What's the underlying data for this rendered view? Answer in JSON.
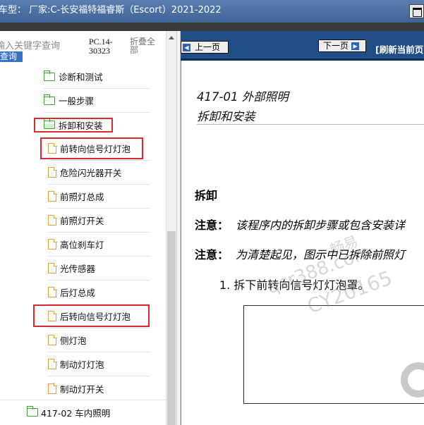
{
  "titlebar": {
    "title": "车型： 厂家:C-长安福特福睿斯（Escort）2021-2022"
  },
  "left_panel": {
    "search_placeholder": "输入关键字查询",
    "query_button": "查询",
    "pc_code": "PC.14-30323",
    "collapse_all": "折叠全部",
    "tree": [
      {
        "label": "诊断和测试",
        "icon": "folder-icon"
      },
      {
        "label": "一般步骤",
        "icon": "folder-icon"
      },
      {
        "label": "拆卸和安装",
        "icon": "folder-open-icon",
        "highlighted": true
      },
      {
        "label": "前转向信号灯灯泡",
        "icon": "document-icon",
        "highlighted": true
      },
      {
        "label": "危险闪光器开关",
        "icon": "document-icon"
      },
      {
        "label": "前照灯总成",
        "icon": "document-icon"
      },
      {
        "label": "前照灯开关",
        "icon": "document-icon"
      },
      {
        "label": "高位刹车灯",
        "icon": "document-icon"
      },
      {
        "label": "光传感器",
        "icon": "document-icon"
      },
      {
        "label": "后灯总成",
        "icon": "document-icon"
      },
      {
        "label": "后转向信号灯灯泡",
        "icon": "document-icon",
        "highlighted": true
      },
      {
        "label": "侧灯泡",
        "icon": "document-icon"
      },
      {
        "label": "制动灯灯泡",
        "icon": "document-icon"
      },
      {
        "label": "制动灯开关",
        "icon": "document-icon"
      },
      {
        "label": "417-02 车内照明",
        "icon": "folder-icon"
      }
    ]
  },
  "right_panel": {
    "prev_button": "上一页",
    "next_button": "下一页",
    "refresh": "[刷新当前页",
    "section_title": "417-01 外部照明",
    "section_subtitle": "拆卸和安装",
    "heading": "拆卸",
    "note1_key": "注意：",
    "note1_text": "该程序内的拆卸步骤或包含安装详",
    "note2_key": "注意：",
    "note2_text": "为清楚起见，图示中已拆除前照灯",
    "step1": "1. 拆下前转向信号灯灯泡罩。",
    "watermarks": [
      "畅易",
      "qcr388.com",
      "CY20165"
    ]
  }
}
